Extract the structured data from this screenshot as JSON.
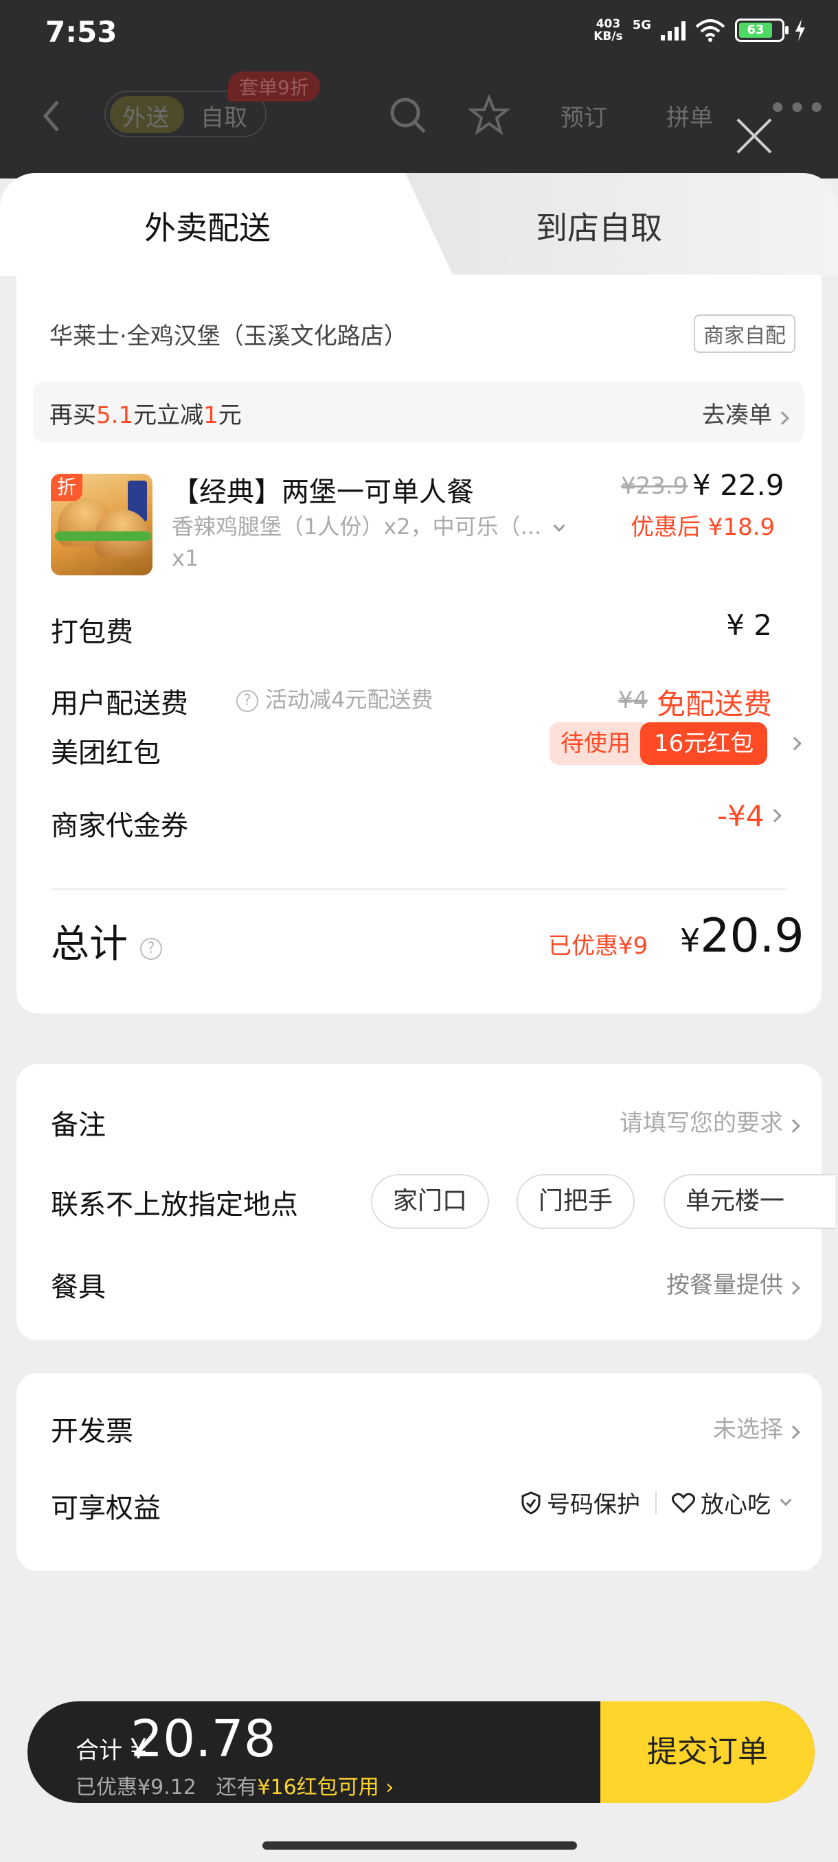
{
  "status": {
    "time": "7:53",
    "net_speed_top": "403",
    "net_speed_bottom": "KB/s",
    "network": "5G",
    "battery": "63"
  },
  "behind": {
    "tab_delivery": "外送",
    "tab_pickup": "自取",
    "badge": "套单9折",
    "reserve": "预订",
    "group": "拼单"
  },
  "tabs": {
    "delivery": "外卖配送",
    "pickup": "到店自取"
  },
  "store": {
    "name": "华莱士·全鸡汉堡（玉溪文化路店）",
    "tag": "商家自配"
  },
  "promo": {
    "prefix": "再买",
    "amount": "5.1",
    "middle": "元立减",
    "discount": "1",
    "suffix": "元",
    "link": "去凑单"
  },
  "item": {
    "badge": "折",
    "name": "【经典】两堡一可单人餐",
    "desc": "香辣鸡腿堡（1人份）x2，中可乐（...",
    "qty": "x1",
    "price_old": "¥23.9",
    "price_new": "¥ 22.9",
    "price_after": "优惠后 ¥18.9"
  },
  "fees": {
    "packing_label": "打包费",
    "packing_value": "¥ 2",
    "delivery_label": "用户配送费",
    "delivery_note": "活动减4元配送费",
    "delivery_old": "¥4",
    "delivery_free": "免配送费",
    "redpacket_label": "美团红包",
    "redpacket_status": "待使用",
    "redpacket_value": "16元红包",
    "voucher_label": "商家代金券",
    "voucher_value": "-¥4"
  },
  "total": {
    "label": "总计",
    "saved": "已优惠¥9",
    "currency": "¥",
    "value": "20.9"
  },
  "remarks": {
    "label": "备注",
    "placeholder": "请填写您的要求"
  },
  "contact": {
    "label": "联系不上放指定地点",
    "options": [
      "家门口",
      "门把手",
      "单元楼一"
    ]
  },
  "cutlery": {
    "label": "餐具",
    "value": "按餐量提供"
  },
  "invoice": {
    "label": "开发票",
    "value": "未选择"
  },
  "benefits": {
    "label": "可享权益",
    "b1": "号码保护",
    "b2": "放心吃"
  },
  "paybar": {
    "total_label": "合计",
    "currency": "¥",
    "total": "20.78",
    "saved": "已优惠¥9.12",
    "more": "还有",
    "more_highlight": "¥16红包可用",
    "submit": "提交订单"
  }
}
